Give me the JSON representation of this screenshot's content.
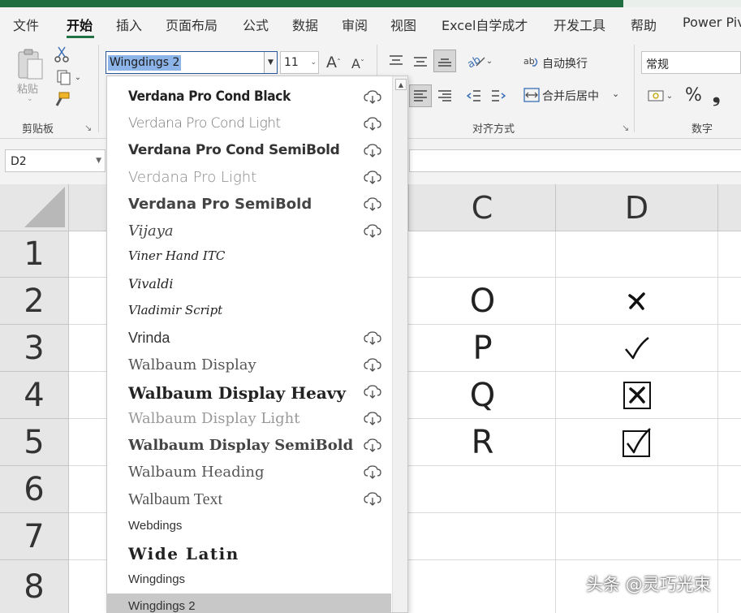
{
  "menu": {
    "tabs": [
      {
        "label": "文件"
      },
      {
        "label": "开始"
      },
      {
        "label": "插入"
      },
      {
        "label": "页面布局"
      },
      {
        "label": "公式"
      },
      {
        "label": "数据"
      },
      {
        "label": "审阅"
      },
      {
        "label": "视图"
      },
      {
        "label": "Excel自学成才"
      },
      {
        "label": "开发工具"
      },
      {
        "label": "帮助"
      },
      {
        "label": "Power Piv"
      }
    ],
    "active_tab": "开始"
  },
  "ribbon": {
    "clipboard": {
      "paste_label": "粘贴",
      "group_label": "剪贴板"
    },
    "font": {
      "current_font": "Wingdings 2",
      "size": "11"
    },
    "alignment": {
      "wrap_text_label": "自动换行",
      "merge_label": "合并后居中",
      "group_label": "对齐方式"
    },
    "number": {
      "format": "常规",
      "percent": "%",
      "comma": "❟",
      "group_label": "数字"
    }
  },
  "formula_bar": {
    "name_box": "D2",
    "formula": ""
  },
  "grid": {
    "columns": [
      "C",
      "D"
    ],
    "rows": [
      "1",
      "2",
      "3",
      "4",
      "5",
      "6",
      "7",
      "8"
    ],
    "cells": {
      "C2": "O",
      "C3": "P",
      "C4": "Q",
      "C5": "R",
      "D2": "cross-mark",
      "D3": "check-mark",
      "D4": "boxed-cross",
      "D5": "boxed-check"
    }
  },
  "font_dropdown": {
    "items": [
      {
        "name": "Verdana Pro Cond Black",
        "cloud": true
      },
      {
        "name": "Verdana Pro Cond Light",
        "cloud": true
      },
      {
        "name": "Verdana Pro Cond SemiBold",
        "cloud": true
      },
      {
        "name": "Verdana Pro Light",
        "cloud": true
      },
      {
        "name": "Verdana Pro SemiBold",
        "cloud": true
      },
      {
        "name": "Vijaya",
        "cloud": true
      },
      {
        "name": "Viner Hand ITC",
        "cloud": false
      },
      {
        "name": "Vivaldi",
        "cloud": false
      },
      {
        "name": "Vladimir Script",
        "cloud": false
      },
      {
        "name": "Vrinda",
        "cloud": true
      },
      {
        "name": "Walbaum Display",
        "cloud": true
      },
      {
        "name": "Walbaum Display Heavy",
        "cloud": true
      },
      {
        "name": "Walbaum Display Light",
        "cloud": true
      },
      {
        "name": "Walbaum Display SemiBold",
        "cloud": true
      },
      {
        "name": "Walbaum Heading",
        "cloud": true
      },
      {
        "name": "Walbaum Text",
        "cloud": true
      },
      {
        "name": "Webdings",
        "cloud": false
      },
      {
        "name": "Wide Latin",
        "cloud": false
      },
      {
        "name": "Wingdings",
        "cloud": false
      },
      {
        "name": "Wingdings 2",
        "cloud": false
      }
    ],
    "selected": "Wingdings 2"
  },
  "watermark": {
    "text": "头条 @灵巧光束"
  },
  "colors": {
    "excel_green": "#217346",
    "selection_blue": "#8cb4e8",
    "selected_item": "#c8c8c8"
  }
}
